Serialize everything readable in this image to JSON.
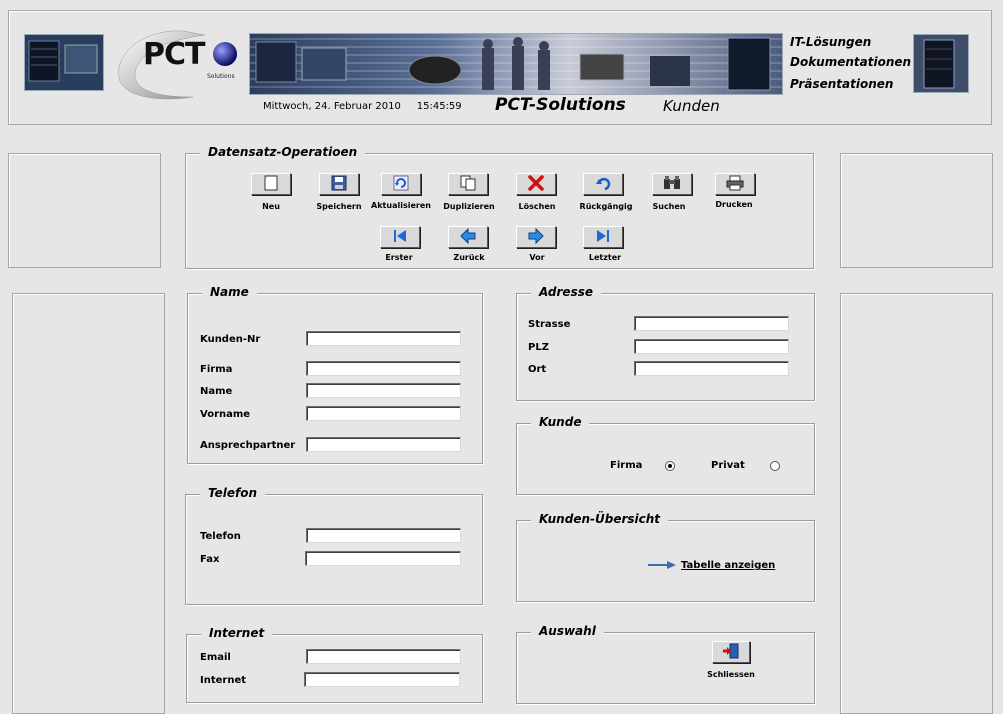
{
  "header": {
    "logo_text": "PCT",
    "logo_sub": "Solutions",
    "datetime": "Mittwoch, 24. Februar 2010     15:45:59",
    "app_name": "PCT-Solutions",
    "section": "Kunden",
    "services": [
      "IT-Lösungen",
      "Dokumentationen",
      "Präsentationen"
    ]
  },
  "ops": {
    "title": "Datensatz-Operatioen",
    "row1": [
      {
        "label": "Neu",
        "icon": "new-document-icon"
      },
      {
        "label": "Speichern",
        "icon": "floppy-disk-icon"
      },
      {
        "label": "Aktualisieren",
        "icon": "refresh-icon"
      },
      {
        "label": "Duplizieren",
        "icon": "duplicate-icon"
      },
      {
        "label": "Löschen",
        "icon": "delete-x-icon"
      },
      {
        "label": "Rückgängig",
        "icon": "undo-icon"
      },
      {
        "label": "Suchen",
        "icon": "binoculars-icon"
      },
      {
        "label": "Drucken",
        "icon": "printer-icon"
      }
    ],
    "row2": [
      {
        "label": "Erster",
        "icon": "first-record-icon"
      },
      {
        "label": "Zurück",
        "icon": "back-arrow-icon"
      },
      {
        "label": "Vor",
        "icon": "forward-arrow-icon"
      },
      {
        "label": "Letzter",
        "icon": "last-record-icon"
      }
    ]
  },
  "name_group": {
    "title": "Name",
    "kundennr": {
      "label": "Kunden-Nr",
      "value": ""
    },
    "firma": {
      "label": "Firma",
      "value": ""
    },
    "name": {
      "label": "Name",
      "value": ""
    },
    "vorname": {
      "label": "Vorname",
      "value": ""
    },
    "ansprech": {
      "label": "Ansprechpartner",
      "value": ""
    }
  },
  "telefon_group": {
    "title": "Telefon",
    "telefon": {
      "label": "Telefon",
      "value": ""
    },
    "fax": {
      "label": "Fax",
      "value": ""
    }
  },
  "internet_group": {
    "title": "Internet",
    "email": {
      "label": "Email",
      "value": ""
    },
    "internet": {
      "label": "Internet",
      "value": ""
    }
  },
  "adresse_group": {
    "title": "Adresse",
    "strasse": {
      "label": "Strasse",
      "value": ""
    },
    "plz": {
      "label": "PLZ",
      "value": ""
    },
    "ort": {
      "label": "Ort",
      "value": ""
    }
  },
  "kunde_group": {
    "title": "Kunde",
    "firma_label": "Firma",
    "privat_label": "Privat",
    "selected": "Firma"
  },
  "uebersicht_group": {
    "title": "Kunden-Übersicht",
    "link": "Tabelle anzeigen"
  },
  "auswahl_group": {
    "title": "Auswahl",
    "close_label": "Schliessen"
  },
  "colors": {
    "background": "#e6e6e6",
    "banner_dark": "#1a2a44",
    "link_arrow": "#3a6db5"
  }
}
